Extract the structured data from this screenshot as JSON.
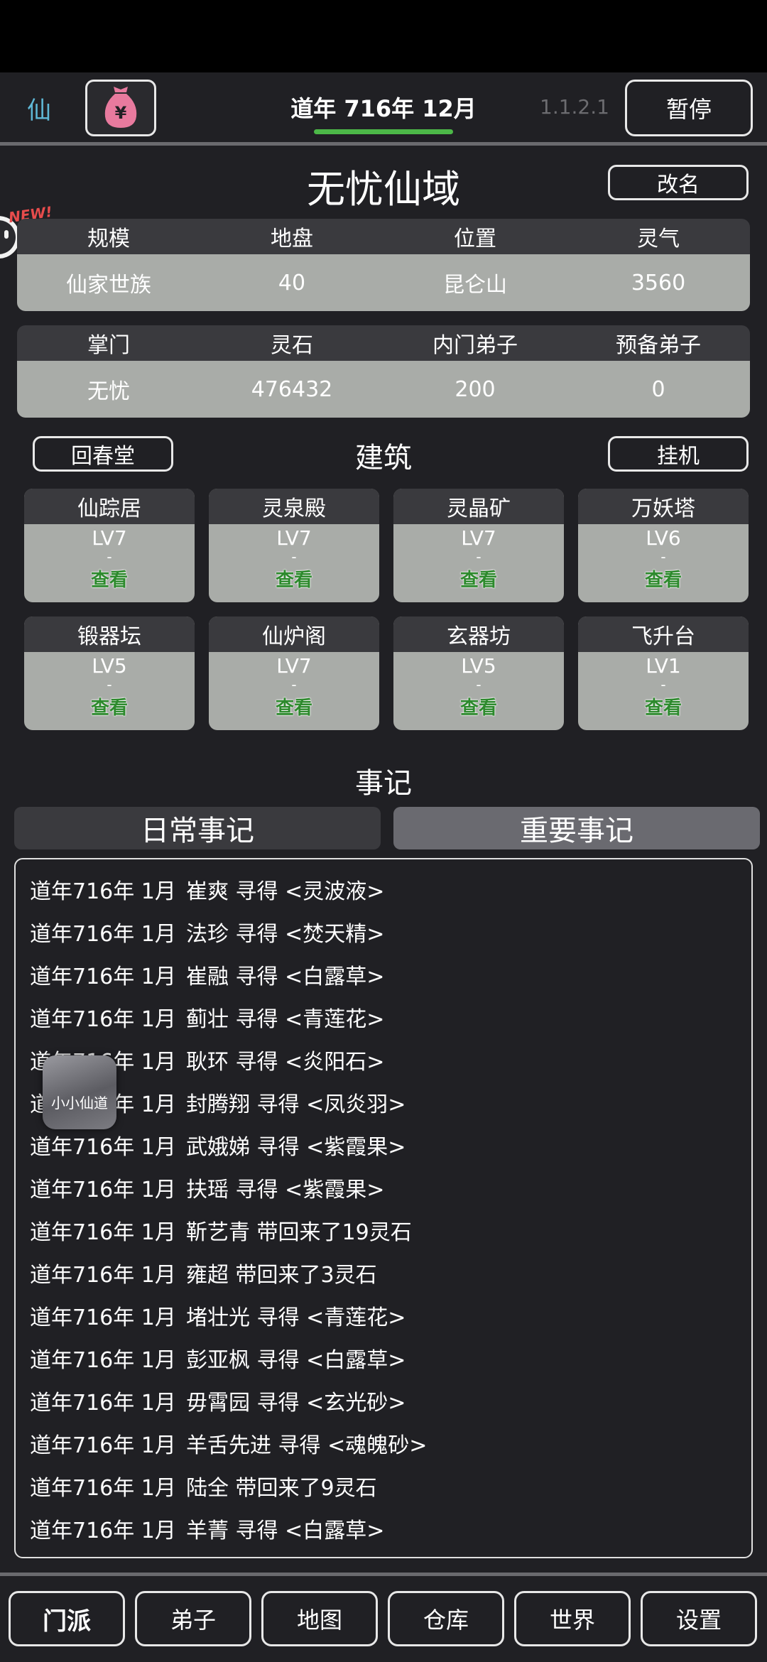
{
  "header": {
    "left_label": "仙",
    "date": "道年 716年 12月",
    "version": "1.1.2.1",
    "pause_label": "暂停"
  },
  "sect": {
    "name": "无忧仙域",
    "rename_label": "改名",
    "new_badge": "NEW!"
  },
  "info_row1": {
    "headers": [
      "规模",
      "地盘",
      "位置",
      "灵气"
    ],
    "values": [
      "仙家世族",
      "40",
      "昆仑山",
      "3560"
    ]
  },
  "info_row2": {
    "headers": [
      "掌门",
      "灵石",
      "内门弟子",
      "预备弟子"
    ],
    "values": [
      "无忧",
      "476432",
      "200",
      "0"
    ]
  },
  "buildings_section": {
    "left_button": "回春堂",
    "title": "建筑",
    "right_button": "挂机",
    "items": [
      {
        "name": "仙踪居",
        "level": "LV7",
        "dash": "-",
        "view": "查看"
      },
      {
        "name": "灵泉殿",
        "level": "LV7",
        "dash": "-",
        "view": "查看"
      },
      {
        "name": "灵晶矿",
        "level": "LV7",
        "dash": "-",
        "view": "查看"
      },
      {
        "name": "万妖塔",
        "level": "LV6",
        "dash": "-",
        "view": "查看"
      },
      {
        "name": "锻器坛",
        "level": "LV5",
        "dash": "-",
        "view": "查看"
      },
      {
        "name": "仙炉阁",
        "level": "LV7",
        "dash": "-",
        "view": "查看"
      },
      {
        "name": "玄器坊",
        "level": "LV5",
        "dash": "-",
        "view": "查看"
      },
      {
        "name": "飞升台",
        "level": "LV1",
        "dash": "-",
        "view": "查看"
      }
    ]
  },
  "events": {
    "title": "事记",
    "tabs": [
      "日常事记",
      "重要事记"
    ],
    "log": [
      {
        "date": "道年716年 1月",
        "text": "崔爽 寻得 <灵波液>"
      },
      {
        "date": "道年716年 1月",
        "text": "法珍 寻得 <焚天精>"
      },
      {
        "date": "道年716年 1月",
        "text": "崔融 寻得 <白露草>"
      },
      {
        "date": "道年716年 1月",
        "text": "蓟壮 寻得 <青莲花>"
      },
      {
        "date": "道年716年 1月",
        "text": "耿环 寻得 <炎阳石>"
      },
      {
        "date": "道年716年 1月",
        "text": "封腾翔 寻得 <凤炎羽>"
      },
      {
        "date": "道年716年 1月",
        "text": "武娥娣 寻得 <紫霞果>"
      },
      {
        "date": "道年716年 1月",
        "text": "扶瑶 寻得 <紫霞果>"
      },
      {
        "date": "道年716年 1月",
        "text": "靳艺青 带回来了19灵石"
      },
      {
        "date": "道年716年 1月",
        "text": "雍超 带回来了3灵石"
      },
      {
        "date": "道年716年 1月",
        "text": "堵壮光 寻得 <青莲花>"
      },
      {
        "date": "道年716年 1月",
        "text": "彭亚枫 寻得 <白露草>"
      },
      {
        "date": "道年716年 1月",
        "text": "毋霄园 寻得 <玄光砂>"
      },
      {
        "date": "道年716年 1月",
        "text": "羊舌先进 寻得 <魂魄砂>"
      },
      {
        "date": "道年716年 1月",
        "text": "陆全 带回来了9灵石"
      },
      {
        "date": "道年716年 1月",
        "text": "羊菁 寻得 <白露草>"
      }
    ]
  },
  "floating_app": {
    "label": "小小仙道"
  },
  "nav": [
    "门派",
    "弟子",
    "地图",
    "仓库",
    "世界",
    "设置"
  ],
  "colors": {
    "background": "#202024",
    "cell_gray": "#a9aca8",
    "header_gray": "#3a3a3e",
    "progress_green": "#4cb848",
    "view_green": "#2d8a2d",
    "accent_blue": "#5fb8d6",
    "money_pink": "#e87a9e"
  }
}
